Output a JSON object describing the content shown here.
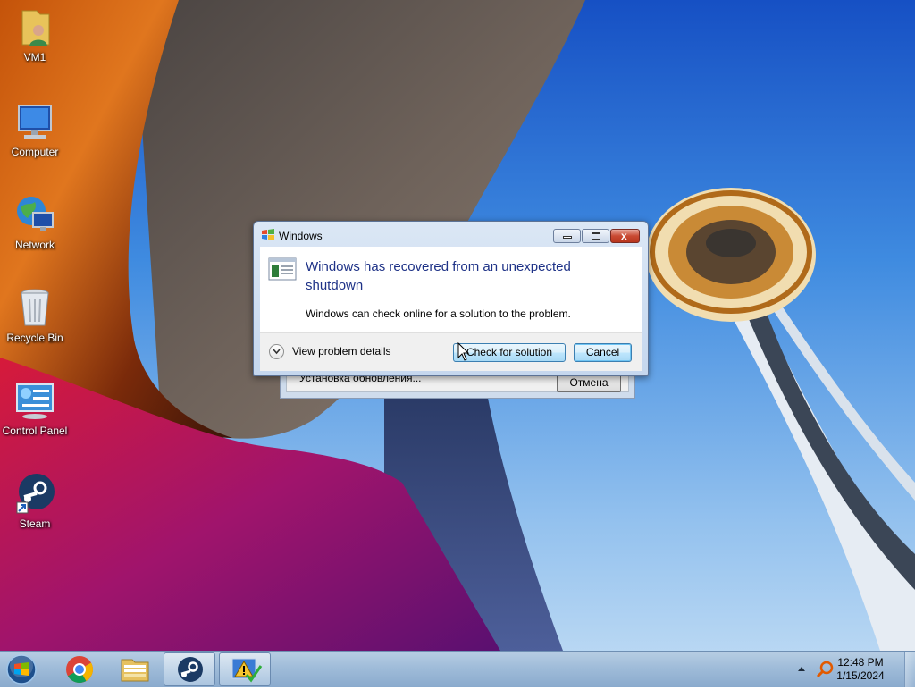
{
  "desktop": {
    "icons": [
      {
        "label": "VM1"
      },
      {
        "label": "Computer"
      },
      {
        "label": "Network"
      },
      {
        "label": "Recycle Bin"
      },
      {
        "label": "Control Panel"
      },
      {
        "label": "Steam"
      }
    ]
  },
  "background_dialog": {
    "text": "Установка обновления...",
    "cancel_label": "Отмена"
  },
  "dialog": {
    "title": "Windows",
    "heading": "Windows has recovered from an unexpected shutdown",
    "description": "Windows can check online for a solution to the problem.",
    "view_details_label": "View problem details",
    "check_button_label": "Check for solution",
    "cancel_button_label": "Cancel",
    "close_glyph": "x"
  },
  "taskbar": {
    "items": [
      {
        "icon": "start-orb-icon"
      },
      {
        "icon": "chrome-icon"
      },
      {
        "icon": "file-explorer-icon"
      },
      {
        "icon": "steam-icon"
      },
      {
        "icon": "action-center-warning-icon"
      }
    ]
  },
  "tray": {
    "time": "12:48 PM",
    "date": "1/15/2024"
  }
}
